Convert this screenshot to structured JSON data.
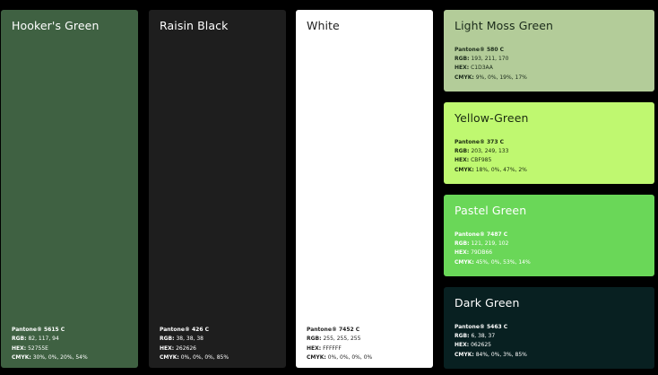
{
  "colors": [
    {
      "name": "Hooker's Green",
      "swatch": "#3F6142",
      "pantone": "Pantone® 5615 C",
      "rgb_label": "RGB:",
      "rgb": "82, 117, 94",
      "hex_label": "HEX:",
      "hex": "52755E",
      "cmyk_label": "CMYK:",
      "cmyk": "30%, 0%, 20%, 54%"
    },
    {
      "name": "Raisin Black",
      "swatch": "#1E1E1E",
      "pantone": "Pantone® 426 C",
      "rgb_label": "RGB:",
      "rgb": "38, 38, 38",
      "hex_label": "HEX:",
      "hex": "262626",
      "cmyk_label": "CMYK:",
      "cmyk": "0%, 0%, 0%, 85%"
    },
    {
      "name": "White",
      "swatch": "#FFFFFF",
      "pantone": "Pantone® 7452 C",
      "rgb_label": "RGB:",
      "rgb": "255, 255, 255",
      "hex_label": "HEX:",
      "hex": "FFFFFF",
      "cmyk_label": "CMYK:",
      "cmyk": "0%, 0%, 0%, 0%"
    },
    {
      "name": "Light Moss Green",
      "swatch": "#B3CC99",
      "pantone": "Pantone® 580 C",
      "rgb_label": "RGB:",
      "rgb": "193, 211, 170",
      "hex_label": "HEX:",
      "hex": "C1D3AA",
      "cmyk_label": "CMYK:",
      "cmyk": "9%, 0%, 19%, 17%"
    },
    {
      "name": "Yellow-Green",
      "swatch": "#BFF870",
      "pantone": "Pantone® 373 C",
      "rgb_label": "RGB:",
      "rgb": "203, 249, 133",
      "hex_label": "HEX:",
      "hex": "CBF985",
      "cmyk_label": "CMYK:",
      "cmyk": "18%, 0%, 47%, 2%"
    },
    {
      "name": "Pastel Green",
      "swatch": "#6AD758",
      "pantone": "Pantone® 7487 C",
      "rgb_label": "RGB:",
      "rgb": "121, 219, 102",
      "hex_label": "HEX:",
      "hex": "79DB66",
      "cmyk_label": "CMYK:",
      "cmyk": "45%, 0%, 53%, 14%"
    },
    {
      "name": "Dark Green",
      "swatch": "#082021",
      "pantone": "Pantone® 5463 C",
      "rgb_label": "RGB:",
      "rgb": "6, 38, 37",
      "hex_label": "HEX:",
      "hex": "062625",
      "cmyk_label": "CMYK:",
      "cmyk": "84%, 0%, 3%, 85%"
    }
  ]
}
